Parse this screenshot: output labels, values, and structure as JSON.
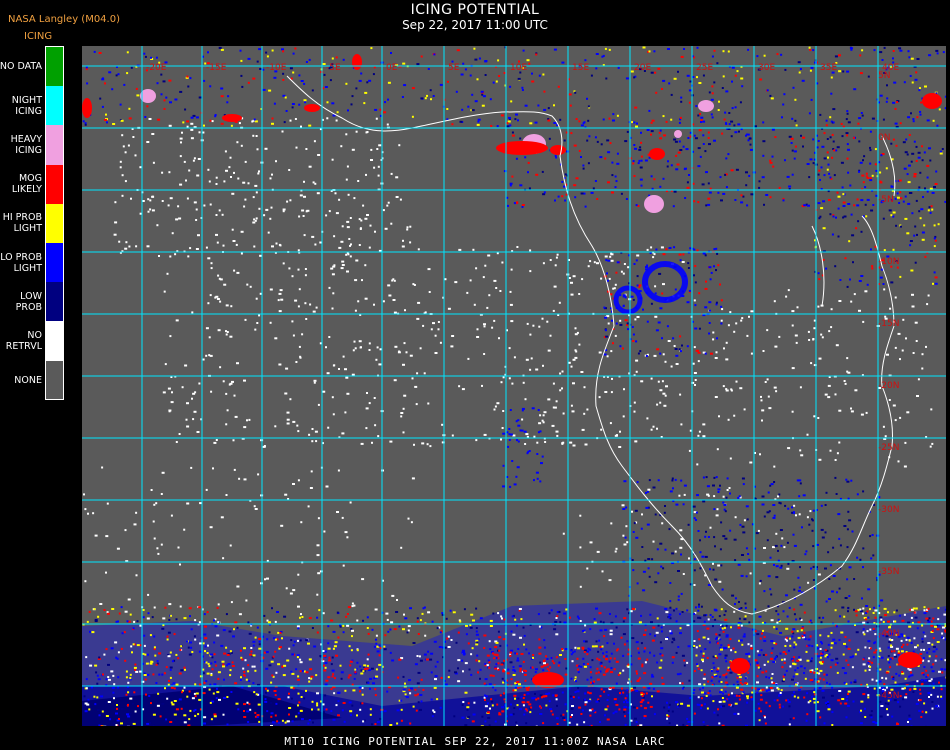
{
  "header": {
    "organization": "NASA Langley (M04.0)",
    "product": "ICING",
    "title": "ICING POTENTIAL",
    "subtitle": "Sep 22, 2017 11:00 UTC"
  },
  "legend": [
    {
      "label": "NO DATA",
      "color": "#00a000"
    },
    {
      "label": "NIGHT\nICING",
      "color": "#00ffff"
    },
    {
      "label": "HEAVY\nICING",
      "color": "#f0a0e0"
    },
    {
      "label": "MOG\nLIKELY",
      "color": "#ff0000"
    },
    {
      "label": "HI PROB\nLIGHT",
      "color": "#ffff00"
    },
    {
      "label": "LO PROB\nLIGHT",
      "color": "#0000ff"
    },
    {
      "label": "LOW\nPROB",
      "color": "#000080"
    },
    {
      "label": "NO\nRETRVL",
      "color": "#ffffff"
    },
    {
      "label": "NONE",
      "color": "#5a5a5a"
    }
  ],
  "map": {
    "background": "#5a5a5a",
    "grid_color": "#00e5ff",
    "coastline_color": "#ffffff",
    "top_labels": [
      "-20E",
      "-15E",
      "-10E",
      "-5E",
      "0E",
      "5E",
      "10E",
      "15E",
      "20E",
      "25E",
      "30E",
      "35E",
      "40E"
    ],
    "right_labels": [
      "5N",
      "0N",
      "-5N",
      "-10N",
      "-15N",
      "-20N",
      "-25N",
      "-30N",
      "-35N",
      "-40N",
      "-45N"
    ]
  },
  "footer": "MT10  ICING POTENTIAL   SEP 22, 2017 11:00Z   NASA LARC"
}
